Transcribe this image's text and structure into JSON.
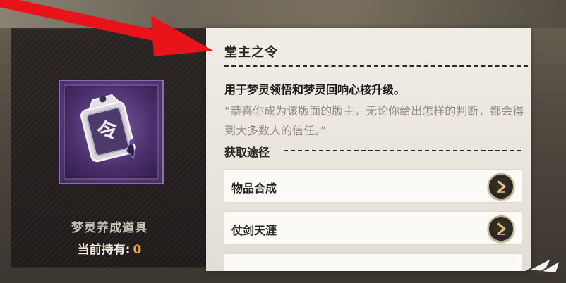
{
  "item": {
    "icon": "command-token-icon",
    "type_label": "梦灵养成道具",
    "owned_label": "当前持有:",
    "owned_count": "0"
  },
  "detail": {
    "title": "堂主之令",
    "description": "用于梦灵领悟和梦灵回响心核升级。",
    "quote": "“恭喜你成为该版面的版主，无论你给出怎样的判断，都会得到大多数人的信任。”",
    "sources_heading": "获取途径",
    "sources": [
      {
        "label": "物品合成",
        "icon": "arrow-right-icon"
      },
      {
        "label": "仗剑天涯",
        "icon": "arrow-right-icon"
      }
    ]
  },
  "colors": {
    "annotation_arrow": "#e8141a",
    "item_frame": "#8f6bbb",
    "owned_count": "#e7a744"
  }
}
